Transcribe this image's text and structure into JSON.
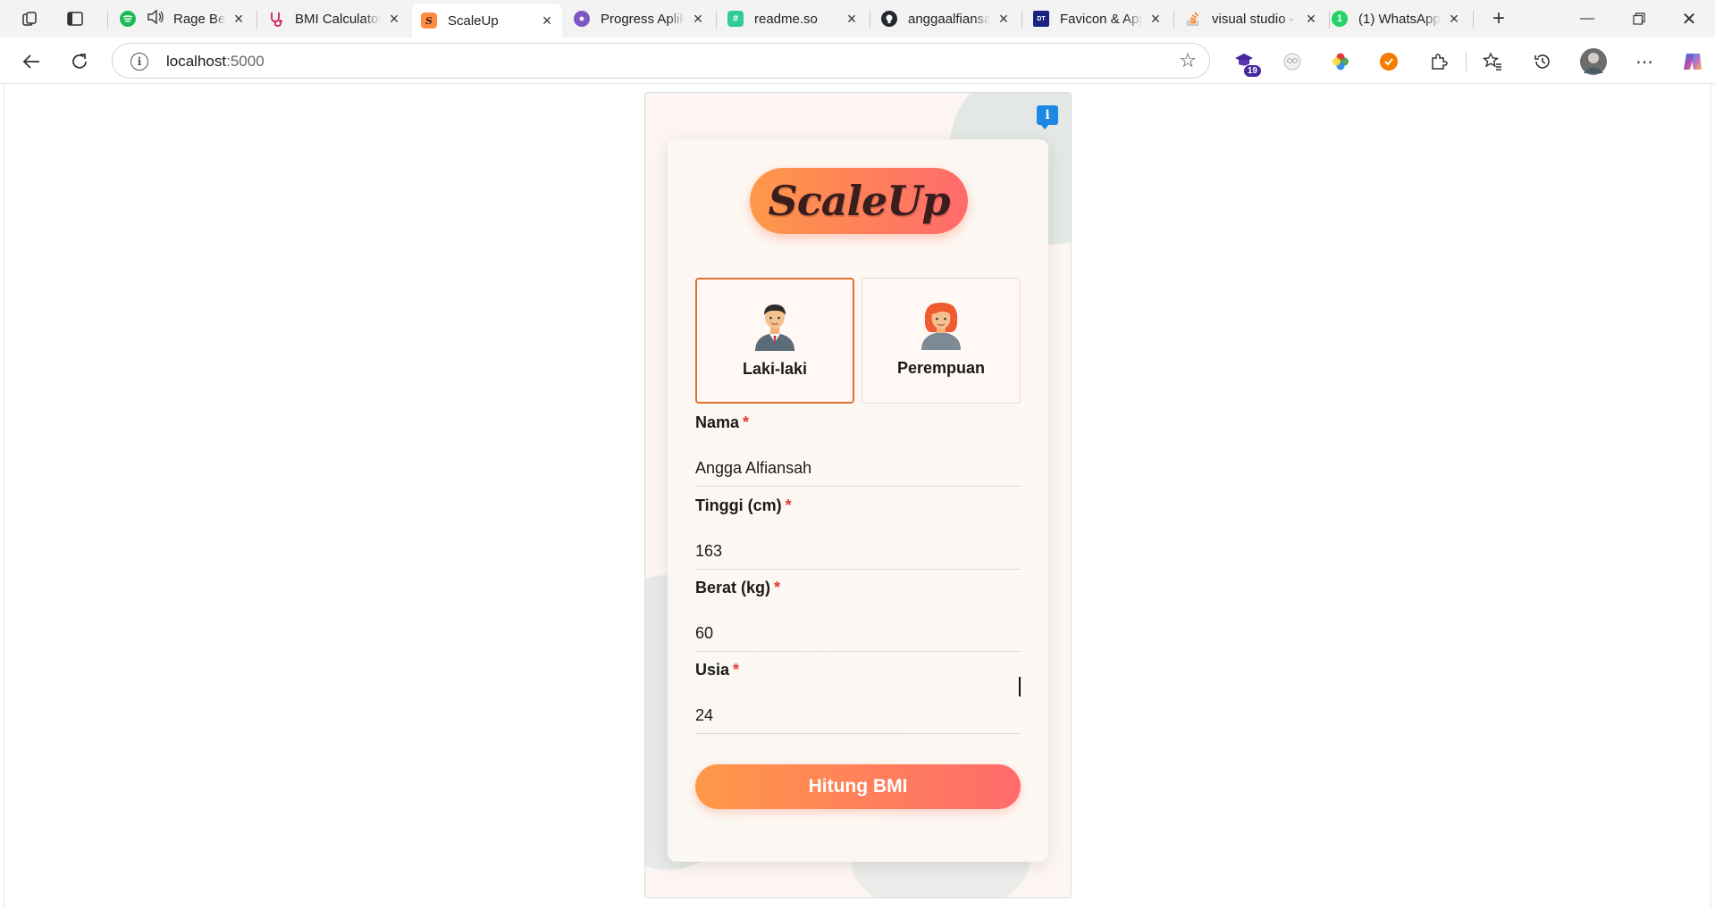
{
  "browser": {
    "tabs": [
      {
        "title": "Rage Bender",
        "favicon": "spotify-icon",
        "color": "#1db954",
        "audio": true
      },
      {
        "title": "BMI Calculator",
        "favicon": "stethoscope-icon",
        "color": "#d81b60"
      },
      {
        "title": "ScaleUp",
        "favicon": "scaleup-icon",
        "color": "#ff8c42",
        "active": true
      },
      {
        "title": "Progress Aplikasi",
        "favicon": "app-icon",
        "color": "#7e57c2"
      },
      {
        "title": "readme.so",
        "favicon": "readme-icon",
        "color": "#2ecc9a"
      },
      {
        "title": "anggaalfiansah",
        "favicon": "github-icon",
        "color": "#24292e"
      },
      {
        "title": "Favicon & App",
        "favicon": "favicon-icon",
        "color": "#1a237e"
      },
      {
        "title": "visual studio -",
        "favicon": "stackoverflow-icon",
        "color": "#f48024"
      },
      {
        "title": "(1) WhatsApp",
        "favicon": "whatsapp-icon",
        "color": "#25d366"
      }
    ],
    "address": {
      "host": "localhost",
      "port": ":5000"
    },
    "extension_badge": "19"
  },
  "app": {
    "info_badge": "i",
    "logo_text": "ScaleUp",
    "genders": [
      {
        "label": "Laki-laki",
        "selected": true
      },
      {
        "label": "Perempuan",
        "selected": false
      }
    ],
    "fields": {
      "nama": {
        "label": "Nama",
        "value": "Angga Alfiansah"
      },
      "tinggi": {
        "label": "Tinggi (cm)",
        "value": "163"
      },
      "berat": {
        "label": "Berat (kg)",
        "value": "60"
      },
      "usia": {
        "label": "Usia",
        "value": "24"
      }
    },
    "required_mark": "*",
    "submit_label": "Hitung BMI",
    "accent": "#ff8c42",
    "accent_end": "#ff6b6b"
  }
}
